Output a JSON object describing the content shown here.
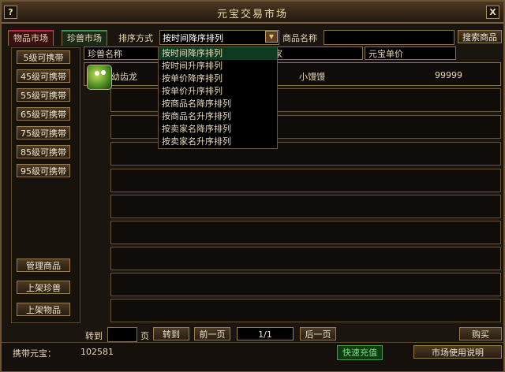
{
  "window": {
    "title": "元宝交易市场",
    "help_label": "?",
    "close_label": "X"
  },
  "tabs": [
    "物品市场",
    "珍兽市场"
  ],
  "sort": {
    "label": "排序方式",
    "selected": "按时间降序排列",
    "options": [
      "按时间降序排列",
      "按时间升序排列",
      "按单价降序排列",
      "按单价升序排列",
      "按商品名降序排列",
      "按商品名升序排列",
      "按卖家名降序排列",
      "按卖家名升序排列"
    ]
  },
  "search": {
    "label": "商品名称",
    "value": "",
    "button": "搜索商品"
  },
  "sidebar": {
    "levels": [
      "5级可携带",
      "45级可携带",
      "55级可携带",
      "65级可携带",
      "75级可携带",
      "85级可携带",
      "95级可携带"
    ],
    "manage": "管理商品",
    "list_pet": "上架珍兽",
    "list_item": "上架物品"
  },
  "table": {
    "columns": [
      "珍兽名称",
      "家",
      "元宝单价"
    ],
    "rows": [
      {
        "name": "幼齿龙",
        "seller": "小馒馒",
        "price": "99999"
      }
    ]
  },
  "pager": {
    "goto_label": "转到",
    "page_unit": "页",
    "goto_button": "转到",
    "prev": "前一页",
    "page": "1/1",
    "next": "后一页",
    "buy": "购买"
  },
  "footer": {
    "carry_label": "携带元宝：",
    "carry_value": "102581",
    "recharge": "快速充值",
    "help": "市场使用说明"
  },
  "colors": {
    "accent_green": "#0d3a20",
    "border": "#8a7048"
  }
}
